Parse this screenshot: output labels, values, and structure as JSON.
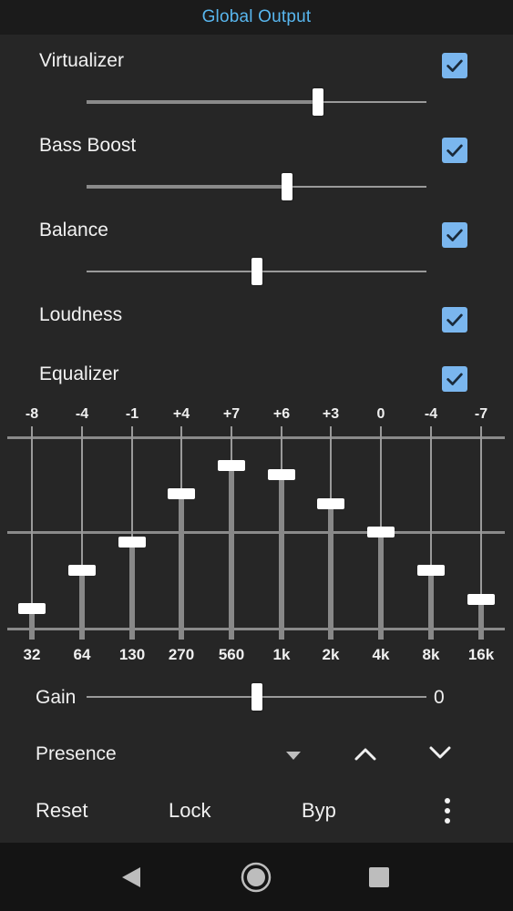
{
  "header": {
    "title": "Global Output"
  },
  "effects": {
    "virtualizer": {
      "label": "Virtualizer",
      "checked": true,
      "level": 0.68
    },
    "bass_boost": {
      "label": "Bass Boost",
      "checked": true,
      "level": 0.59
    },
    "balance": {
      "label": "Balance",
      "checked": true,
      "level": 0.5
    },
    "loudness": {
      "label": "Loudness",
      "checked": true
    },
    "equalizer": {
      "label": "Equalizer",
      "checked": true
    }
  },
  "equalizer_bands": [
    {
      "freq": "32",
      "value": "-8"
    },
    {
      "freq": "64",
      "value": "-4"
    },
    {
      "freq": "130",
      "value": "-1"
    },
    {
      "freq": "270",
      "value": "+4"
    },
    {
      "freq": "560",
      "value": "+7"
    },
    {
      "freq": "1k",
      "value": "+6"
    },
    {
      "freq": "2k",
      "value": "+3"
    },
    {
      "freq": "4k",
      "value": "0"
    },
    {
      "freq": "8k",
      "value": "-4"
    },
    {
      "freq": "16k",
      "value": "-7"
    }
  ],
  "gain": {
    "label": "Gain",
    "value": "0",
    "level": 0.5
  },
  "preset": {
    "label": "Presence"
  },
  "toolbar": {
    "reset": "Reset",
    "lock": "Lock",
    "bypass": "Byp"
  },
  "icons": {
    "checkbox": "check-icon",
    "dropdown": "caret-down-icon",
    "up": "chevron-up-icon",
    "down": "chevron-down-icon",
    "menu": "more-vertical-icon",
    "back": "back-triangle-icon",
    "home": "home-circle-icon",
    "recents": "recents-square-icon"
  },
  "colors": {
    "accent": "#58b6ee",
    "checkbox": "#7ab6ee",
    "background": "#262626"
  }
}
